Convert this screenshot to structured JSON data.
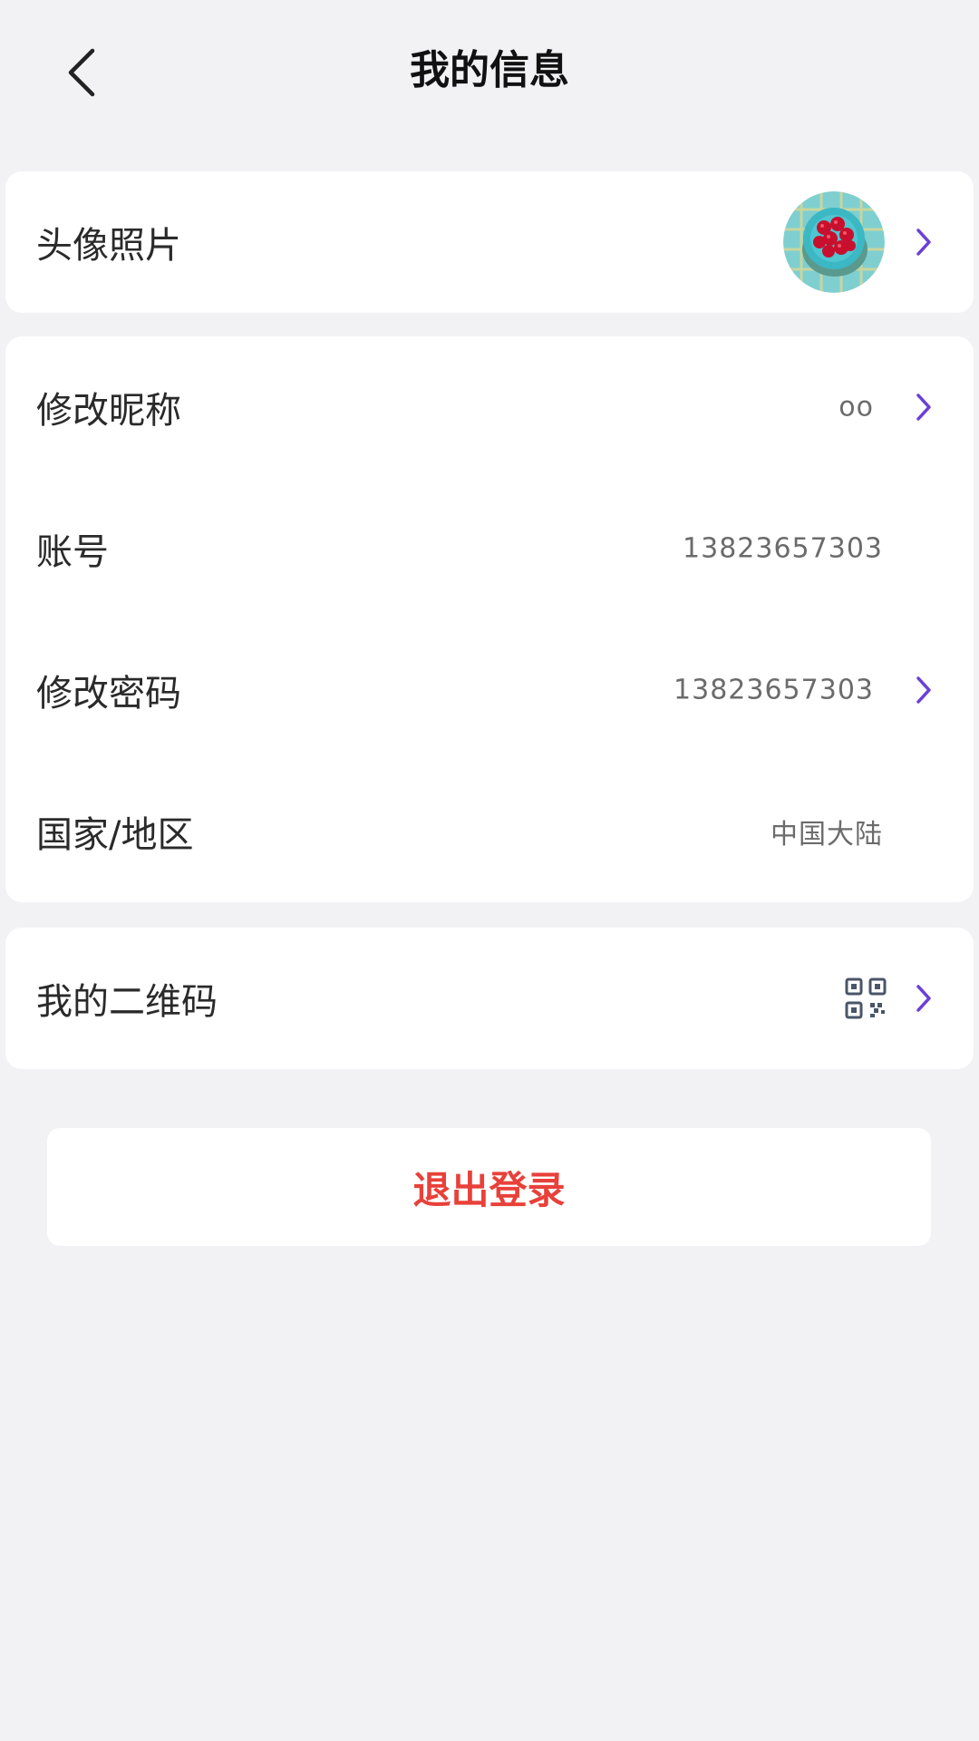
{
  "header": {
    "title": "我的信息",
    "back_icon": "chevron-left-icon"
  },
  "avatar_row": {
    "label": "头像照片"
  },
  "info_rows": {
    "nickname": {
      "label": "修改昵称",
      "value": "oo"
    },
    "account": {
      "label": "账号",
      "value": "13823657303"
    },
    "password": {
      "label": "修改密码",
      "value": "13823657303"
    },
    "region": {
      "label": "国家/地区",
      "value": "中国大陆"
    }
  },
  "qr_row": {
    "label": "我的二维码",
    "icon": "qr-code-icon"
  },
  "logout": {
    "label": "退出登录"
  },
  "colors": {
    "background": "#f2f2f5",
    "card": "#ffffff",
    "accent_chevron": "#6b3fd6",
    "logout_text": "#e8413a",
    "value_text": "#6b6b6b"
  }
}
